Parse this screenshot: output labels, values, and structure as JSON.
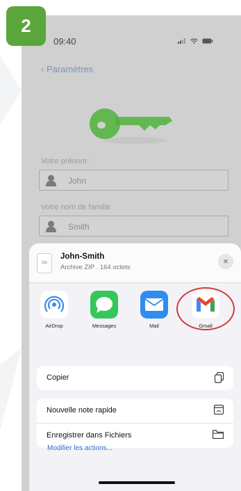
{
  "step": {
    "number": "2",
    "color": "#5aa63a"
  },
  "status_bar": {
    "time": "09:40"
  },
  "nav": {
    "back_label": "Paramètres"
  },
  "form": {
    "first_name": {
      "label": "Votre prénom :",
      "value": "John"
    },
    "last_name": {
      "label": "Votre nom de famille",
      "value": "Smith"
    }
  },
  "share_sheet": {
    "file": {
      "icon_text": "zip",
      "name": "John-Smith",
      "subtitle": "Archive ZIP . 164 octets"
    },
    "close_icon": "×",
    "apps": [
      {
        "label": "AirDrop",
        "icon": "airdrop-icon",
        "color": "#3e8ae8"
      },
      {
        "label": "Messages",
        "icon": "messages-icon",
        "color": "#35c759"
      },
      {
        "label": "Mail",
        "icon": "mail-icon",
        "color": "#2f8cf0"
      },
      {
        "label": "Gmail",
        "icon": "gmail-icon",
        "color": "#ea4335"
      }
    ],
    "actions_group1": [
      {
        "label": "Copier",
        "icon": "copy-icon"
      }
    ],
    "actions_group2": [
      {
        "label": "Nouvelle note rapide",
        "icon": "quick-note-icon"
      },
      {
        "label": "Enregistrer dans Fichiers",
        "icon": "folder-icon"
      }
    ],
    "edit_actions": "Modifier les actions..."
  },
  "highlight": {
    "target": "Gmail",
    "color": "#d23a3a"
  }
}
